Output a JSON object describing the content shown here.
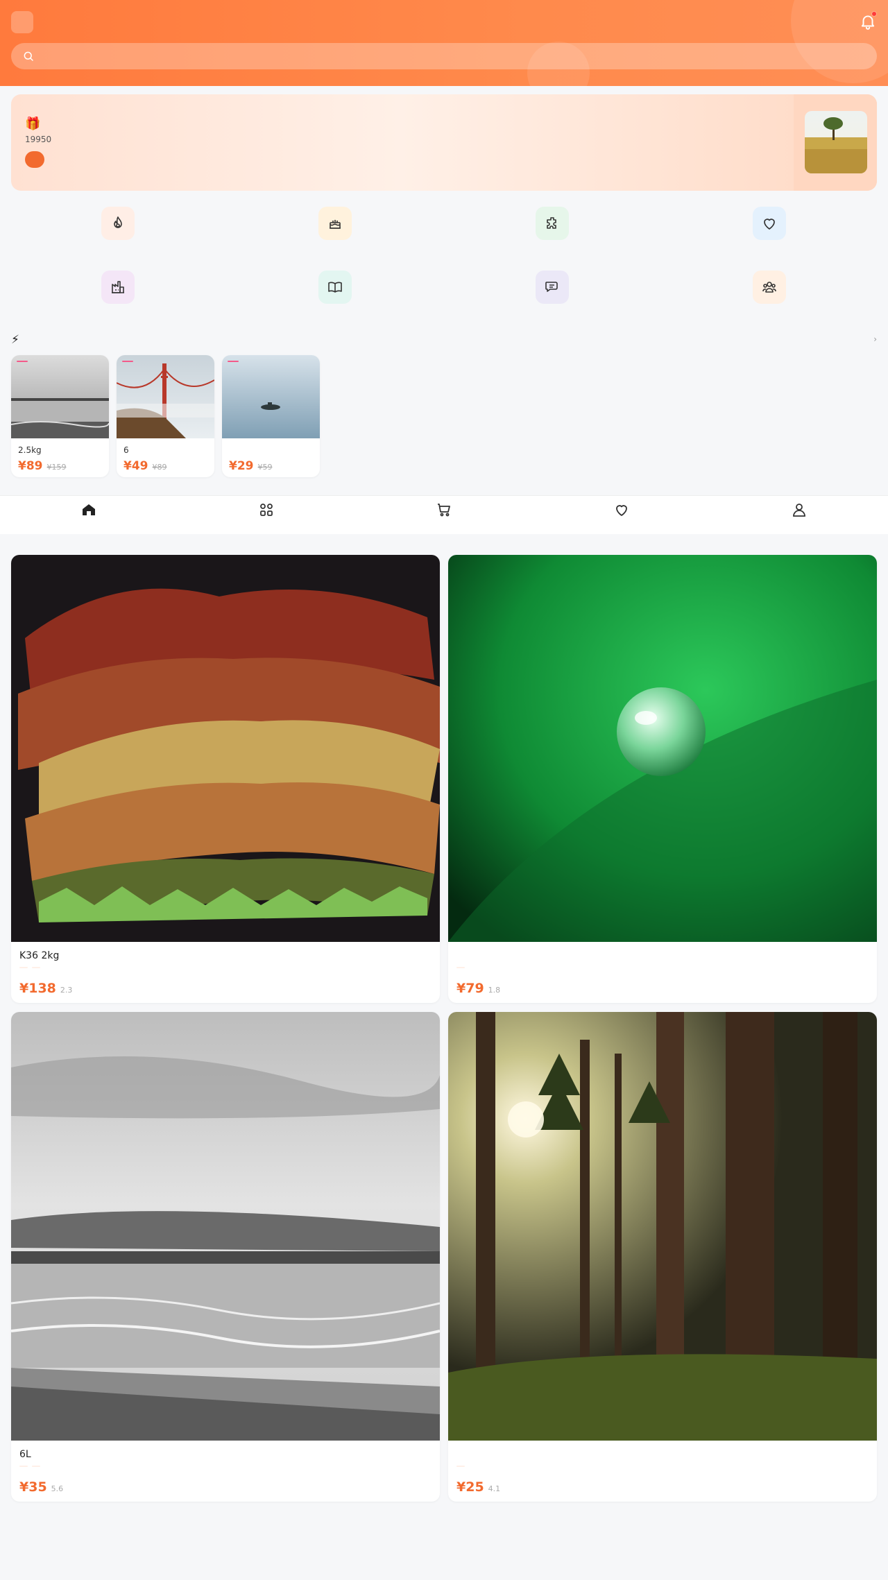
{
  "header": {
    "logo_glyph": "",
    "title": "",
    "search_placeholder": "",
    "bell_icon": "bell-icon"
  },
  "banner": {
    "title": "🎁 ",
    "subtitle": "19950",
    "button": ""
  },
  "categories": [
    {
      "label": "",
      "icon": "flame-icon",
      "bg": "#ffeee6",
      "color": "#f26a2e"
    },
    {
      "label": "",
      "icon": "cake-icon",
      "bg": "#fff2dd",
      "color": "#e08a1e"
    },
    {
      "label": "",
      "icon": "puzzle-icon",
      "bg": "#e6f6ea",
      "color": "#2aa84a"
    },
    {
      "label": "",
      "icon": "heart-icon",
      "bg": "#e4f1fd",
      "color": "#2a7fd4"
    },
    {
      "label": "",
      "icon": "factory-icon",
      "bg": "#f4e6f7",
      "color": "#a24bb8"
    },
    {
      "label": "",
      "icon": "book-icon",
      "bg": "#e3f6f1",
      "color": "#1f9e86"
    },
    {
      "label": "",
      "icon": "chat-icon",
      "bg": "#ebe8f7",
      "color": "#6a57c8"
    },
    {
      "label": "",
      "icon": "group-icon",
      "bg": "#fff0e3",
      "color": "#e0762a"
    }
  ],
  "flash": {
    "title": "⚡ ",
    "more": " ›",
    "items": [
      {
        "tag": "",
        "name": "2.5kg",
        "price": "¥89",
        "old": "¥159"
      },
      {
        "tag": "",
        "name": "6",
        "price": "¥49",
        "old": "¥89"
      },
      {
        "tag": "",
        "name": "",
        "price": "¥29",
        "old": "¥59"
      }
    ]
  },
  "next_section_title": "",
  "tabbar": [
    {
      "label": "",
      "icon": "home-icon",
      "active": true
    },
    {
      "label": "",
      "icon": "grid-icon",
      "active": false
    },
    {
      "label": "",
      "icon": "cart-icon",
      "active": false
    },
    {
      "label": "",
      "icon": "heart-icon",
      "active": false
    },
    {
      "label": "",
      "icon": "user-icon",
      "active": false
    }
  ],
  "products": [
    {
      "name": "K36 2kg ",
      "tags": [
        "",
        ""
      ],
      "price": "¥138",
      "sold": "2.3"
    },
    {
      "name": " ",
      "tags": [
        ""
      ],
      "price": "¥79",
      "sold": "1.8"
    },
    {
      "name": "6L ",
      "tags": [
        "",
        ""
      ],
      "price": "¥35",
      "sold": "5.6"
    },
    {
      "name": " ",
      "tags": [
        ""
      ],
      "price": "¥25",
      "sold": "4.1"
    }
  ],
  "colors": {
    "accent": "#f26a2e",
    "header_start": "#ff7a3d",
    "tag_pink": "#f45a8a"
  }
}
